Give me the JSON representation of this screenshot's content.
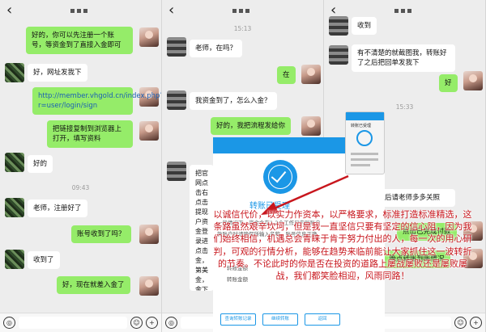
{
  "colors": {
    "wechat_green": "#95ec69",
    "link": "#1a5fb4",
    "modal_blue": "#1b97e6",
    "annotation_red": "#c8161d"
  },
  "panels": [
    {
      "back": "‹",
      "messages": [
        {
          "side": "right",
          "text": "好的，你可以先注册一个账号，等资金到了直接入金即可"
        },
        {
          "side": "left",
          "text": "好，网址发我下"
        },
        {
          "side": "right",
          "text": "http://member.vhgold.cn/index.php?r=user/login/sign",
          "link": true
        },
        {
          "side": "right",
          "text": "把链接复制到浏览器上打开，填写资料"
        },
        {
          "side": "left",
          "text": "好的"
        },
        {
          "type": "time",
          "text": "09:43"
        },
        {
          "side": "left",
          "text": "老师，注册好了"
        },
        {
          "side": "right",
          "text": "账号收到了吗？"
        },
        {
          "side": "left",
          "text": "收到了"
        },
        {
          "side": "right",
          "text": "好，现在就差入金了"
        }
      ]
    },
    {
      "back": "‹",
      "messages": [
        {
          "type": "time",
          "text": "15:13"
        },
        {
          "side": "left",
          "text": "老师，在吗？"
        },
        {
          "side": "right",
          "text": "在"
        },
        {
          "side": "left",
          "text": "我资金到了，怎么入金？"
        },
        {
          "side": "right",
          "text": "好的，我把流程发给你"
        },
        {
          "side": "left",
          "text": "把官网点击右点击提现户资金登录进点击金，第美金，金下一步点击付最后一点去手"
        }
      ]
    },
    {
      "back": "‹",
      "messages": [
        {
          "side": "left",
          "text": "收到"
        },
        {
          "side": "left",
          "text": "有不清楚的就截图我，转账好了之后把回单发我下"
        },
        {
          "side": "right",
          "text": "好"
        },
        {
          "type": "time",
          "text": "15:33"
        },
        {
          "side": "left",
          "text": "好了，以后请老师多多关照"
        },
        {
          "side": "right",
          "text": "点击已完成付款"
        },
        {
          "side": "right",
          "text": "好的，晚点转账到账情况"
        }
      ],
      "modal": {
        "done": "完成",
        "title": "转账已受理",
        "rows": [
          "一般情况下，资金会在1-2个工作日内到账户",
          "款账户时请确保所输入名称、账号信息正确",
          "转账金额",
          "转账金额"
        ],
        "buttons": [
          "查询转账记录",
          "继续转账",
          "返回"
        ],
        "mini_title": "转账已受理"
      },
      "annotation": "以诚信代价，以实力作资本，以严格要求，标准打造标准精选，这条路虽然艰辛坎坷，但是我一直坚信只要有坚定的信心阻，因为我们始终相信，机遇总会青睐于肯于努力付出的人，每一次的用心研判，可观的行情分析，能够在趋势来临前能让大家抓住这一波转折的节奏。不论此时的你是否在投资的道路上屡战屡败还是屡败屡战，我们都笑脸相迎，风雨同路！"
    }
  ],
  "bottom_bar": {
    "voice": "◎",
    "emoji": "☺",
    "plus": "+"
  }
}
